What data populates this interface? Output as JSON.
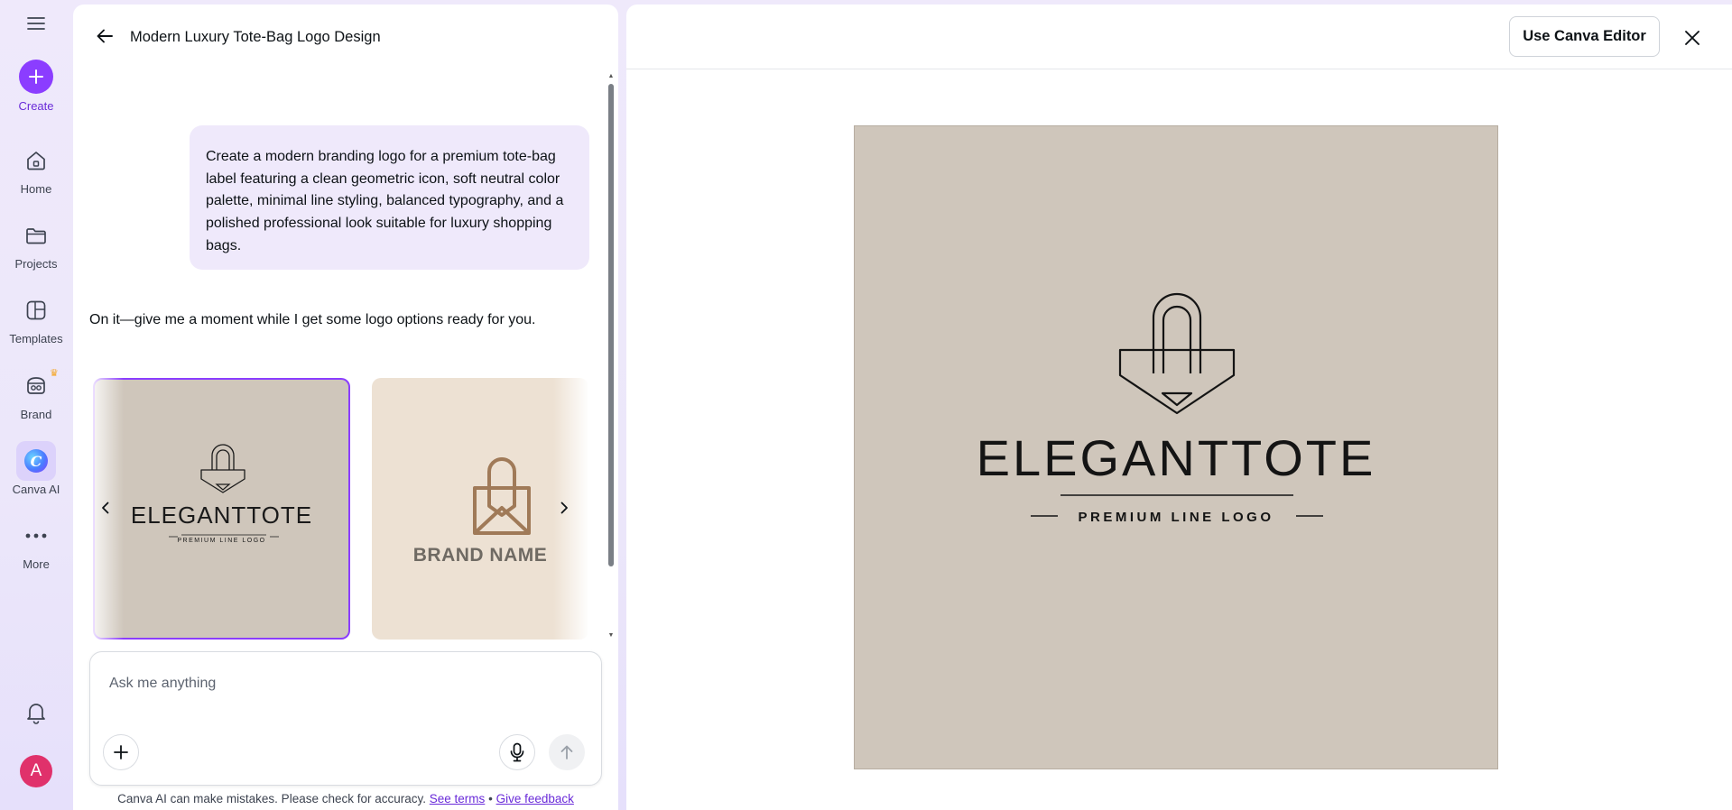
{
  "rail": {
    "create": "Create",
    "home": "Home",
    "projects": "Projects",
    "templates": "Templates",
    "brand": "Brand",
    "canva_ai": "Canva AI",
    "more": "More",
    "avatar_initial": "A"
  },
  "chat": {
    "title": "Modern Luxury Tote-Bag Logo Design",
    "user_message": "Create a modern branding logo for a premium tote-bag label featuring a clean geometric icon, soft neutral color palette, minimal line styling, balanced typography, and a polished professional look suitable for luxury shopping bags.",
    "assistant_message": "On it—give me a moment while I get some logo options ready for you.",
    "options": [
      {
        "title": "ELEGANTTOTE",
        "subtitle": "PREMIUM LINE LOGO"
      },
      {
        "title": "BRAND NAME"
      }
    ],
    "composer_placeholder": "Ask me anything",
    "disclaimer": "Canva AI can make mistakes. Please check for accuracy.",
    "see_terms": "See terms",
    "separator": "•",
    "give_feedback": "Give feedback"
  },
  "preview": {
    "use_editor": "Use Canva Editor",
    "logo_title": "ELEGANTTOTE",
    "logo_subtitle": "PREMIUM LINE LOGO"
  },
  "colors": {
    "accent": "#8b3dff",
    "canvas_bg": "#cfc6bb",
    "card2_bg": "#ede1d3",
    "card2_icon": "#a07a58"
  }
}
